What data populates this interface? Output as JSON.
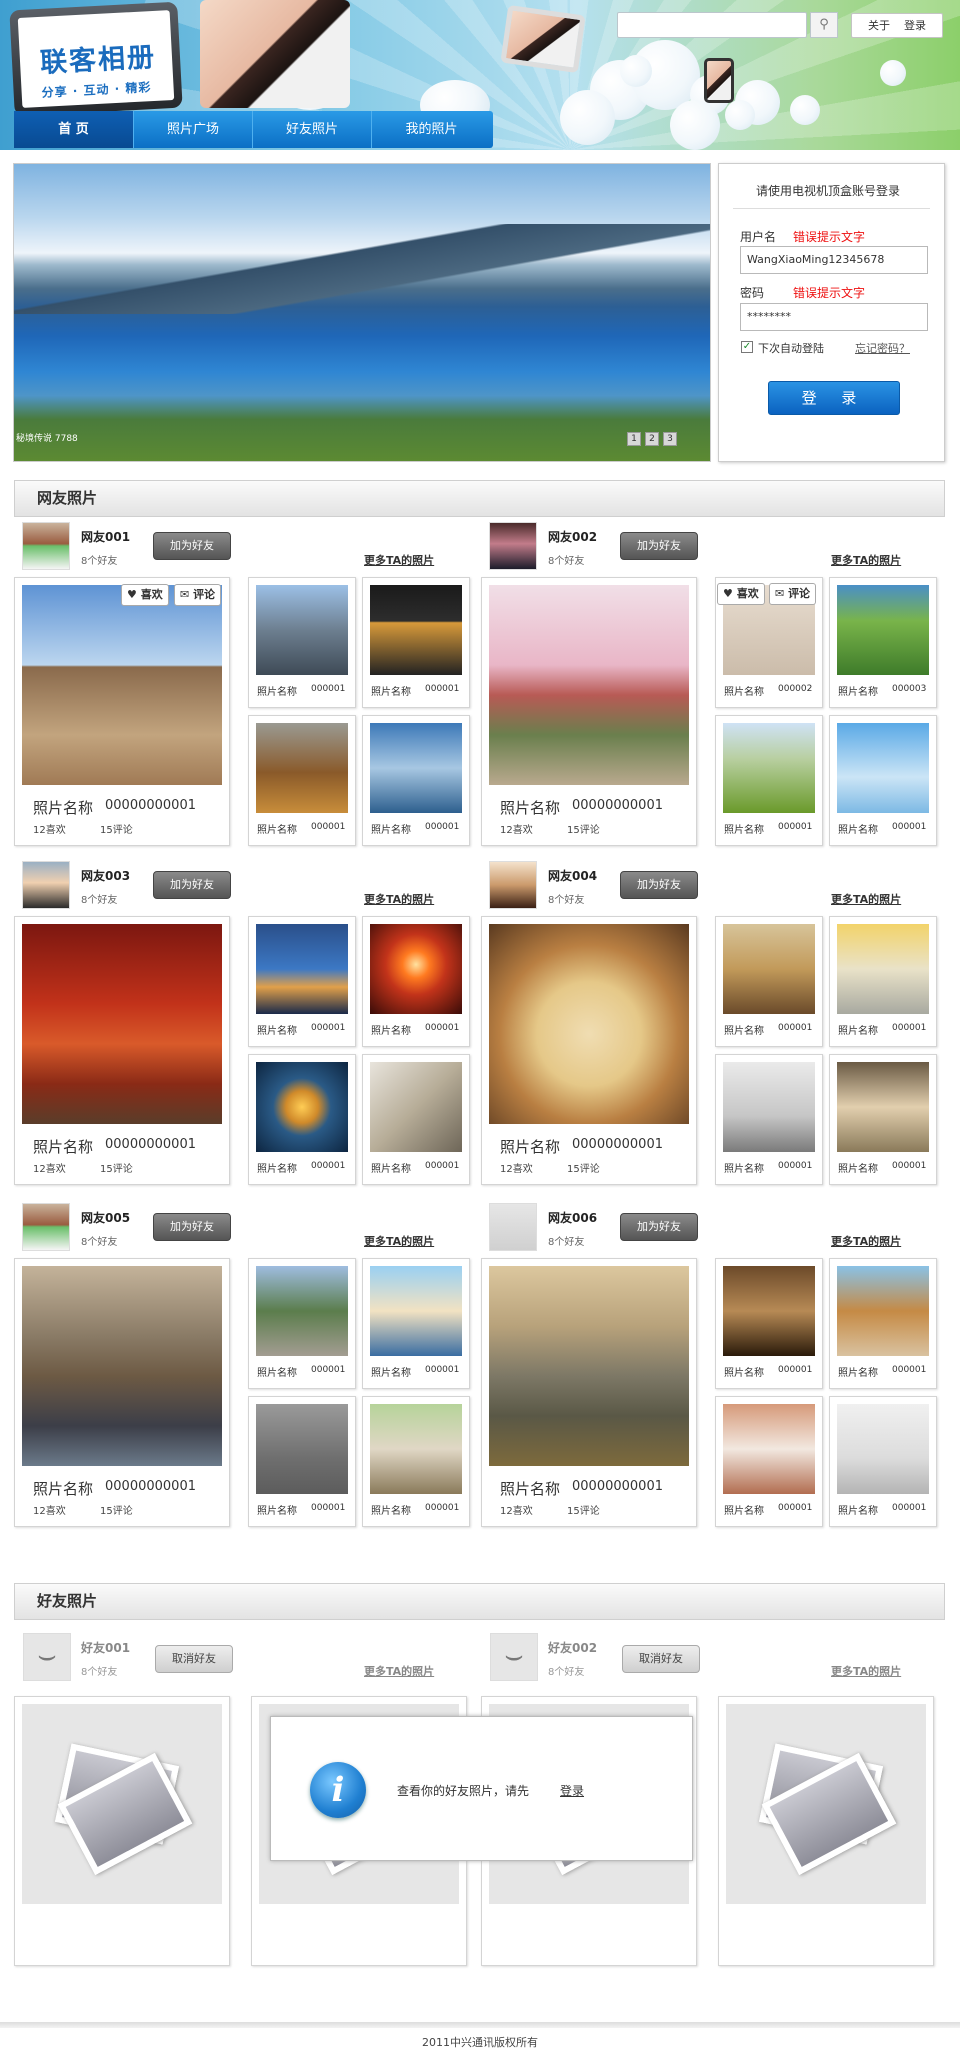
{
  "header": {
    "logo_title": "联客相册",
    "logo_sub": "分享 · 互动 · 精彩",
    "search_placeholder": "",
    "toplinks": [
      "关于",
      "登录"
    ],
    "nav": [
      "首 页",
      "照片广场",
      "好友照片",
      "我的照片"
    ]
  },
  "banner": {
    "caption": "秘境传说 7788",
    "pages": [
      "1",
      "2",
      "3"
    ]
  },
  "login": {
    "title": "请使用电视机顶盒账号登录",
    "user_label": "用户名",
    "user_error": "错误提示文字",
    "user_value": "WangXiaoMing12345678",
    "pwd_label": "密码",
    "pwd_error": "错误提示文字",
    "pwd_value": "********",
    "remember": "下次自动登陆",
    "forgot": "忘记密码？",
    "submit": "登 录"
  },
  "friends_section": {
    "title": "网友照片",
    "like_label": "喜欢",
    "comment_label": "评论",
    "add_label": "加为好友",
    "more_label": "更多TA的照片",
    "users": [
      {
        "name": "网友001",
        "count": "8个好友",
        "big_name": "照片名称",
        "big_no": "00000000001",
        "likes": "12喜欢",
        "comments": "15评论",
        "thumbs": [
          {
            "n": "照片名称",
            "no": "000001"
          },
          {
            "n": "照片名称",
            "no": "000001"
          },
          {
            "n": "照片名称",
            "no": "000001"
          },
          {
            "n": "照片名称",
            "no": "000001"
          }
        ]
      },
      {
        "name": "网友002",
        "count": "8个好友",
        "big_name": "照片名称",
        "big_no": "00000000001",
        "likes": "12喜欢",
        "comments": "15评论",
        "thumbs": [
          {
            "n": "照片名称",
            "no": "000002"
          },
          {
            "n": "照片名称",
            "no": "000003"
          },
          {
            "n": "照片名称",
            "no": "000001"
          },
          {
            "n": "照片名称",
            "no": "000001"
          }
        ]
      },
      {
        "name": "网友003",
        "count": "8个好友",
        "big_name": "照片名称",
        "big_no": "00000000001",
        "likes": "12喜欢",
        "comments": "15评论",
        "thumbs": [
          {
            "n": "照片名称",
            "no": "000001"
          },
          {
            "n": "照片名称",
            "no": "000001"
          },
          {
            "n": "照片名称",
            "no": "000001"
          },
          {
            "n": "照片名称",
            "no": "000001"
          }
        ]
      },
      {
        "name": "网友004",
        "count": "8个好友",
        "big_name": "照片名称",
        "big_no": "00000000001",
        "likes": "12喜欢",
        "comments": "15评论",
        "thumbs": [
          {
            "n": "照片名称",
            "no": "000001"
          },
          {
            "n": "照片名称",
            "no": "000001"
          },
          {
            "n": "照片名称",
            "no": "000001"
          },
          {
            "n": "照片名称",
            "no": "000001"
          }
        ]
      },
      {
        "name": "网友005",
        "count": "8个好友",
        "big_name": "照片名称",
        "big_no": "00000000001",
        "likes": "12喜欢",
        "comments": "15评论",
        "thumbs": [
          {
            "n": "照片名称",
            "no": "000001"
          },
          {
            "n": "照片名称",
            "no": "000001"
          },
          {
            "n": "照片名称",
            "no": "000001"
          },
          {
            "n": "照片名称",
            "no": "000001"
          }
        ]
      },
      {
        "name": "网友006",
        "count": "8个好友",
        "big_name": "照片名称",
        "big_no": "00000000001",
        "likes": "12喜欢",
        "comments": "15评论",
        "thumbs": [
          {
            "n": "照片名称",
            "no": "000001"
          },
          {
            "n": "照片名称",
            "no": "000001"
          },
          {
            "n": "照片名称",
            "no": "000001"
          },
          {
            "n": "照片名称",
            "no": "000001"
          }
        ]
      }
    ]
  },
  "buddy_section": {
    "title": "好友照片",
    "cancel_label": "取消好友",
    "more_label": "更多TA的照片",
    "users": [
      {
        "name": "好友001",
        "count": "8个好友"
      },
      {
        "name": "好友002",
        "count": "8个好友"
      }
    ],
    "modal_text": "查看你的好友照片，请先",
    "modal_link": "登录"
  },
  "footer": {
    "text": "2011中兴通讯版权所有"
  }
}
